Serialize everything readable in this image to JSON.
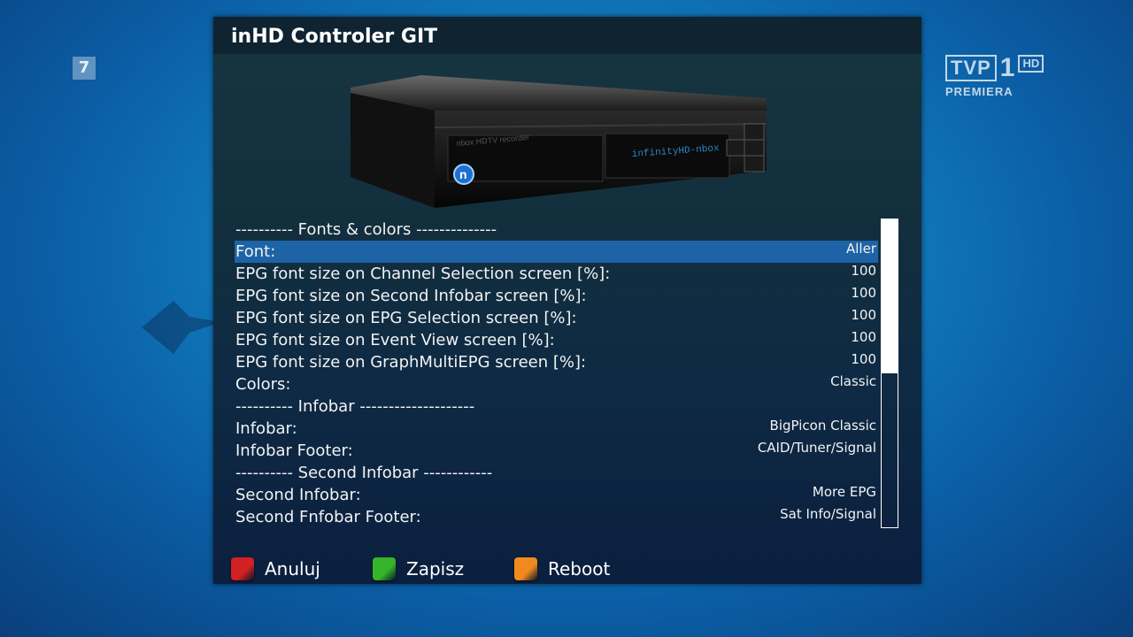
{
  "background": {
    "channel_number": "7",
    "logo": {
      "brand": "TVP",
      "number": "1",
      "hd": "HD",
      "subtitle": "PREMIERA"
    }
  },
  "window": {
    "title": "inHD Controler GIT",
    "device_labels": {
      "front": "nbox HDTV recorder",
      "display": "infinityHD-nbox"
    }
  },
  "settings": [
    {
      "label": "---------- Fonts & colors --------------",
      "value": ""
    },
    {
      "label": "Font:",
      "value": "Aller",
      "selected": true
    },
    {
      "label": "EPG font size on Channel Selection screen [%]:",
      "value": "100"
    },
    {
      "label": "EPG font size on Second Infobar screen [%]:",
      "value": "100"
    },
    {
      "label": "EPG font size on EPG Selection screen [%]:",
      "value": "100"
    },
    {
      "label": "EPG font size on Event View screen [%]:",
      "value": "100"
    },
    {
      "label": "EPG font size on GraphMultiEPG screen [%]:",
      "value": "100"
    },
    {
      "label": "Colors:",
      "value": "Classic"
    },
    {
      "label": "---------- Infobar  --------------------",
      "value": ""
    },
    {
      "label": "Infobar:",
      "value": "BigPicon Classic"
    },
    {
      "label": "Infobar Footer:",
      "value": "CAID/Tuner/Signal"
    },
    {
      "label": "---------- Second Infobar  ------------",
      "value": ""
    },
    {
      "label": "Second Infobar:",
      "value": "More EPG"
    },
    {
      "label": "Second Fnfobar Footer:",
      "value": "Sat Info/Signal"
    }
  ],
  "scrollbar": {
    "position_fraction": 0.0,
    "visible_fraction": 0.5
  },
  "buttons": {
    "red": {
      "label": "Anuluj",
      "color": "#d32020"
    },
    "green": {
      "label": "Zapisz",
      "color": "#34b52a"
    },
    "orange": {
      "label": "Reboot",
      "color": "#f08a1e"
    }
  },
  "colors": {
    "selection": "#1f63a7",
    "panel": "#122f3e",
    "text": "#f2f2f2"
  }
}
